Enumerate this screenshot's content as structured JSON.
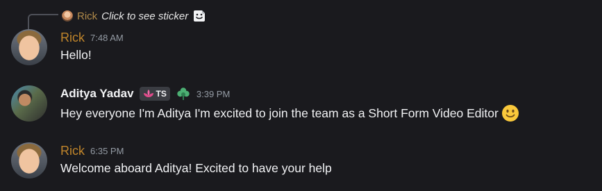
{
  "reply": {
    "author": "Rick",
    "text": "Click to see sticker",
    "sticker_icon": "sticker-icon"
  },
  "messages": [
    {
      "author": "Rick",
      "author_color": "#c0852b",
      "time": "7:48 AM",
      "text": "Hello!"
    },
    {
      "author": "Aditya Yadav",
      "author_color": "#f2f3f5",
      "tag": "TS",
      "tag_icon": "lotus-icon",
      "badge_icon": "clover-icon",
      "time": "3:39 PM",
      "text": "Hey everyone I'm Aditya I'm excited to join the team as a Short Form Video Editor",
      "emoji": "slightly-smiling-face"
    },
    {
      "author": "Rick",
      "author_color": "#c0852b",
      "time": "6:35 PM",
      "text": "Welcome aboard Aditya! Excited to have your help"
    }
  ]
}
